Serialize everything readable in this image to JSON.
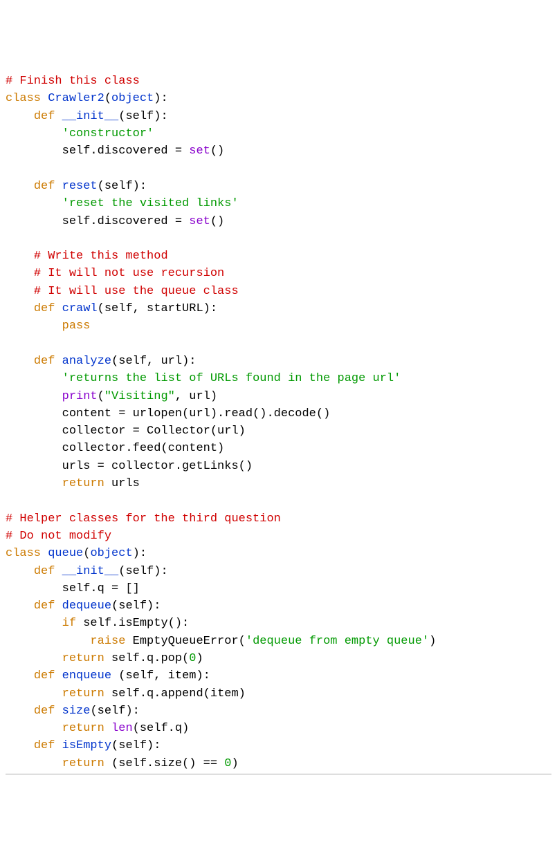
{
  "colors": {
    "comment": "#d00000",
    "keyword": "#cc7a00",
    "classname": "#0033cc",
    "funcname": "#8800cc",
    "string": "#009900",
    "builtin": "#8800cc",
    "default": "#000000"
  },
  "code": {
    "l1": {
      "t": "# Finish this class"
    },
    "l2": {
      "t1": "class",
      "t2": " ",
      "t3": "Crawler2",
      "t4": "(",
      "t5": "object",
      "t6": "):"
    },
    "l3": {
      "t1": "    ",
      "t2": "def",
      "t3": " ",
      "t4": "__init__",
      "t5": "(self):"
    },
    "l4": {
      "t1": "        ",
      "t2": "'constructor'"
    },
    "l5": {
      "t1": "        self.discovered = ",
      "t2": "set",
      "t3": "()"
    },
    "l6": {
      "t": ""
    },
    "l7": {
      "t1": "    ",
      "t2": "def",
      "t3": " ",
      "t4": "reset",
      "t5": "(self):"
    },
    "l8": {
      "t1": "        ",
      "t2": "'reset the visited links'"
    },
    "l9": {
      "t1": "        self.discovered = ",
      "t2": "set",
      "t3": "()"
    },
    "l10": {
      "t": ""
    },
    "l11": {
      "t1": "    ",
      "t2": "# Write this method"
    },
    "l12": {
      "t1": "    ",
      "t2": "# It will not use recursion"
    },
    "l13": {
      "t1": "    ",
      "t2": "# It will use the queue class"
    },
    "l14": {
      "t1": "    ",
      "t2": "def",
      "t3": " ",
      "t4": "crawl",
      "t5": "(self, startURL):"
    },
    "l15": {
      "t1": "        ",
      "t2": "pass"
    },
    "l16": {
      "t": ""
    },
    "l17": {
      "t1": "    ",
      "t2": "def",
      "t3": " ",
      "t4": "analyze",
      "t5": "(self, url):"
    },
    "l18": {
      "t1": "        ",
      "t2": "'returns the list of URLs found in the page url'"
    },
    "l19": {
      "t1": "        ",
      "t2": "print",
      "t3": "(",
      "t4": "\"Visiting\"",
      "t5": ", url)"
    },
    "l20": {
      "t1": "        content = urlopen(url).read().decode()"
    },
    "l21": {
      "t1": "        collector = Collector(url)"
    },
    "l22": {
      "t1": "        collector.feed(content)"
    },
    "l23": {
      "t1": "        urls = collector.getLinks()"
    },
    "l24": {
      "t1": "        ",
      "t2": "return",
      "t3": " urls"
    },
    "l25": {
      "t": ""
    },
    "l26": {
      "t": "# Helper classes for the third question"
    },
    "l27": {
      "t": "# Do not modify"
    },
    "l28": {
      "t1": "class",
      "t2": " ",
      "t3": "queue",
      "t4": "(",
      "t5": "object",
      "t6": "):"
    },
    "l29": {
      "t1": "    ",
      "t2": "def",
      "t3": " ",
      "t4": "__init__",
      "t5": "(self):"
    },
    "l30": {
      "t1": "        self.q = []"
    },
    "l31": {
      "t1": "    ",
      "t2": "def",
      "t3": " ",
      "t4": "dequeue",
      "t5": "(self):"
    },
    "l32": {
      "t1": "        ",
      "t2": "if",
      "t3": " self.isEmpty():"
    },
    "l33": {
      "t1": "            ",
      "t2": "raise",
      "t3": " EmptyQueueError(",
      "t4": "'dequeue from empty queue'",
      "t5": ")"
    },
    "l34": {
      "t1": "        ",
      "t2": "return",
      "t3": " self.q.pop(",
      "t4": "0",
      "t5": ")"
    },
    "l35": {
      "t1": "    ",
      "t2": "def",
      "t3": " ",
      "t4": "enqueue",
      "t5": " (self, item):"
    },
    "l36": {
      "t1": "        ",
      "t2": "return",
      "t3": " self.q.append(item)"
    },
    "l37": {
      "t1": "    ",
      "t2": "def",
      "t3": " ",
      "t4": "size",
      "t5": "(self):"
    },
    "l38": {
      "t1": "        ",
      "t2": "return",
      "t3": " ",
      "t4": "len",
      "t5": "(self.q)"
    },
    "l39": {
      "t1": "    ",
      "t2": "def",
      "t3": " ",
      "t4": "isEmpty",
      "t5": "(self):"
    },
    "l40": {
      "t1": "        ",
      "t2": "return",
      "t3": " (self.size() == ",
      "t4": "0",
      "t5": ")"
    }
  }
}
